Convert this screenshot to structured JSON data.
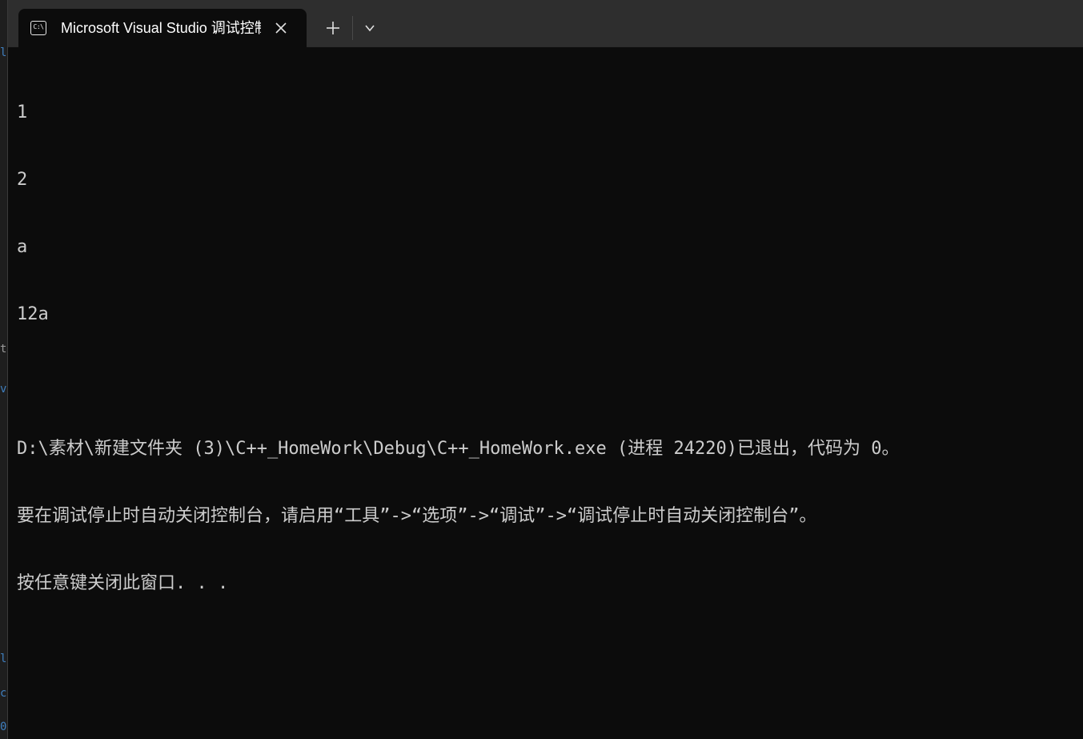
{
  "tab": {
    "icon_text": "C:\\",
    "title": "Microsoft Visual Studio 调试控制台",
    "close_icon": "close-icon"
  },
  "toolbar": {
    "new_tab_icon": "plus-icon",
    "dropdown_icon": "chevron-down-icon"
  },
  "console": {
    "lines": [
      "1",
      "2",
      "a",
      "12a",
      "",
      "D:\\素材\\新建文件夹 (3)\\C++_HomeWork\\Debug\\C++_HomeWork.exe (进程 24220)已退出，代码为 0。",
      "要在调试停止时自动关闭控制台，请启用“工具”->“选项”->“调试”->“调试停止时自动关闭控制台”。",
      "按任意键关闭此窗口. . ."
    ]
  },
  "colors": {
    "console_bg": "#0c0c0c",
    "console_fg": "#cccccc",
    "titlebar_bg": "#2e2e2e",
    "tab_fg": "#ffffff"
  }
}
